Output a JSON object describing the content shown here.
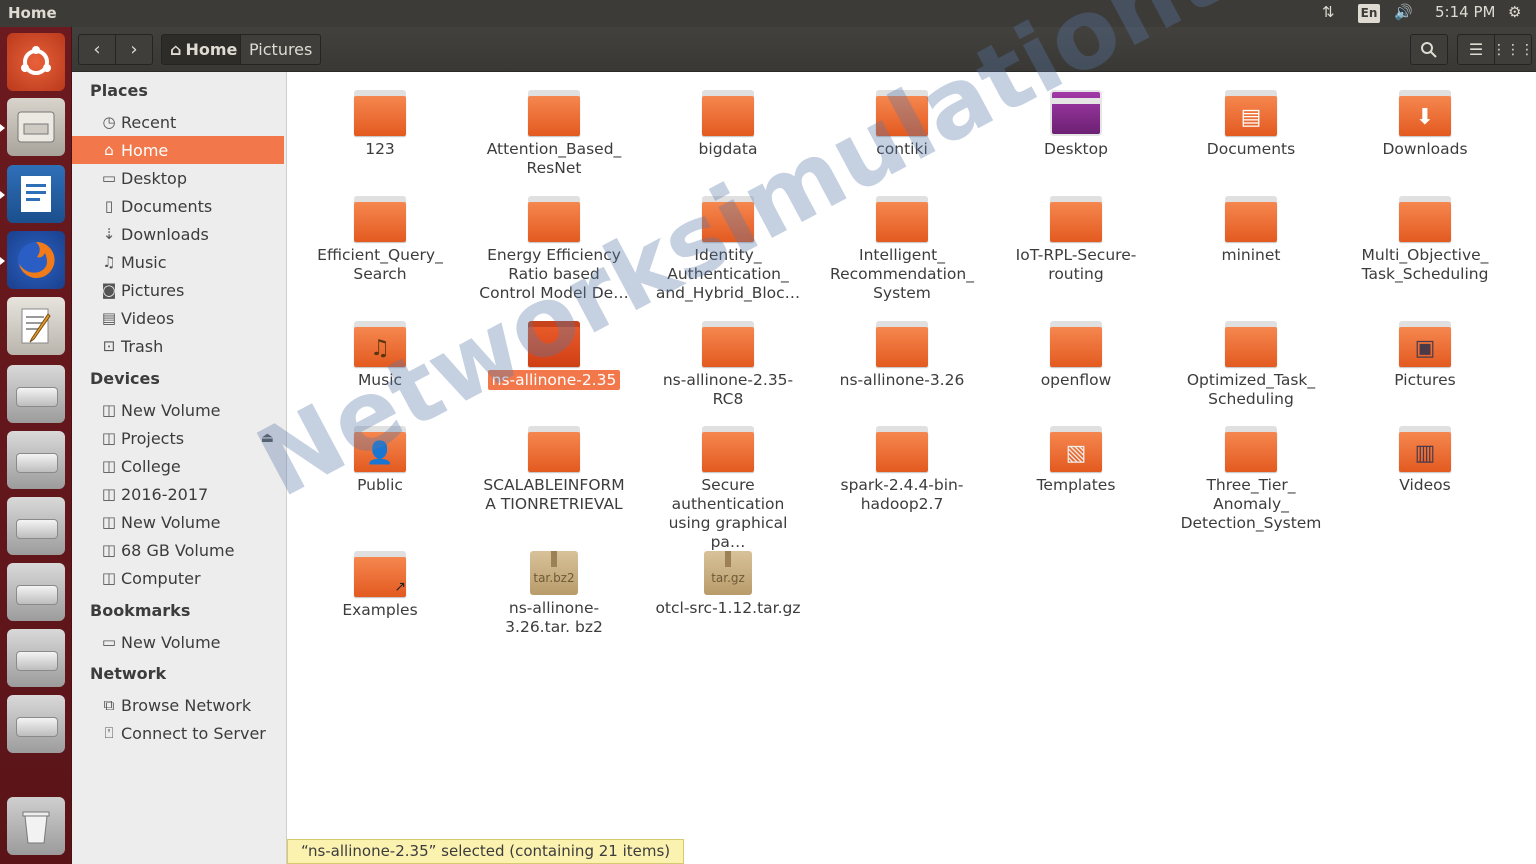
{
  "topbar": {
    "title": "Home",
    "keyboard_layout": "En",
    "time": "5:14 PM",
    "icons": [
      "network-transfer-icon",
      "keyboard-layout-icon",
      "volume-icon",
      "settings-gear-icon"
    ]
  },
  "launcher": {
    "items": [
      "ubuntu-dash-icon",
      "file-manager-icon",
      "libreoffice-writer-icon",
      "firefox-icon",
      "text-editor-icon",
      "drive-icon",
      "drive-icon",
      "drive-icon",
      "drive-icon",
      "drive-icon",
      "drive-icon",
      "trash-icon"
    ]
  },
  "header": {
    "breadcrumb_home": "Home",
    "breadcrumb_next": "Pictures"
  },
  "sidebar": {
    "places_title": "Places",
    "places": [
      {
        "label": "Recent",
        "icon": "clock-icon"
      },
      {
        "label": "Home",
        "icon": "home-icon"
      },
      {
        "label": "Desktop",
        "icon": "folder-icon"
      },
      {
        "label": "Documents",
        "icon": "document-icon"
      },
      {
        "label": "Downloads",
        "icon": "download-icon"
      },
      {
        "label": "Music",
        "icon": "music-icon"
      },
      {
        "label": "Pictures",
        "icon": "camera-icon"
      },
      {
        "label": "Videos",
        "icon": "film-icon"
      },
      {
        "label": "Trash",
        "icon": "trash-icon"
      }
    ],
    "devices_title": "Devices",
    "devices": [
      "New Volume",
      "Projects",
      "College",
      "2016-2017",
      "New Volume",
      "68 GB Volume",
      "Computer"
    ],
    "bookmarks_title": "Bookmarks",
    "bookmarks": [
      "New Volume"
    ],
    "network_title": "Network",
    "network": [
      "Browse Network",
      "Connect to Server"
    ]
  },
  "files": [
    [
      "123",
      "Attention_Based_ ResNet",
      "bigdata",
      "contiki",
      "Desktop",
      "Documents",
      "Downloads"
    ],
    [
      "Efficient_Query_ Search",
      "Energy Efficiency Ratio based Control Model De…",
      "Identity_ Authentication_ and_Hybrid_Bloc…",
      "Intelligent_ Recommendation_ System",
      "IoT-RPL-Secure- routing",
      "mininet",
      "Multi_Objective_ Task_Scheduling"
    ],
    [
      "Music",
      "ns-allinone-2.35",
      "ns-allinone-2.35-RC8",
      "ns-allinone-3.26",
      "openflow",
      "Optimized_Task_ Scheduling",
      "Pictures"
    ],
    [
      "Public",
      "SCALABLEINFORMA TIONRETRIEVAL",
      "Secure authentication using graphical pa…",
      "spark-2.4.4-bin- hadoop2.7",
      "Templates",
      "Three_Tier_ Anomaly_ Detection_System",
      "Videos"
    ],
    [
      "Examples",
      "ns-allinone-3.26.tar. bz2",
      "otcl-src-1.12.tar.gz"
    ]
  ],
  "archive_labels": [
    "tar.bz2",
    "tar.gz"
  ],
  "status": "“ns-allinone-2.35” selected  (containing 21 items)",
  "watermark": "Networksimulationtools.com"
}
